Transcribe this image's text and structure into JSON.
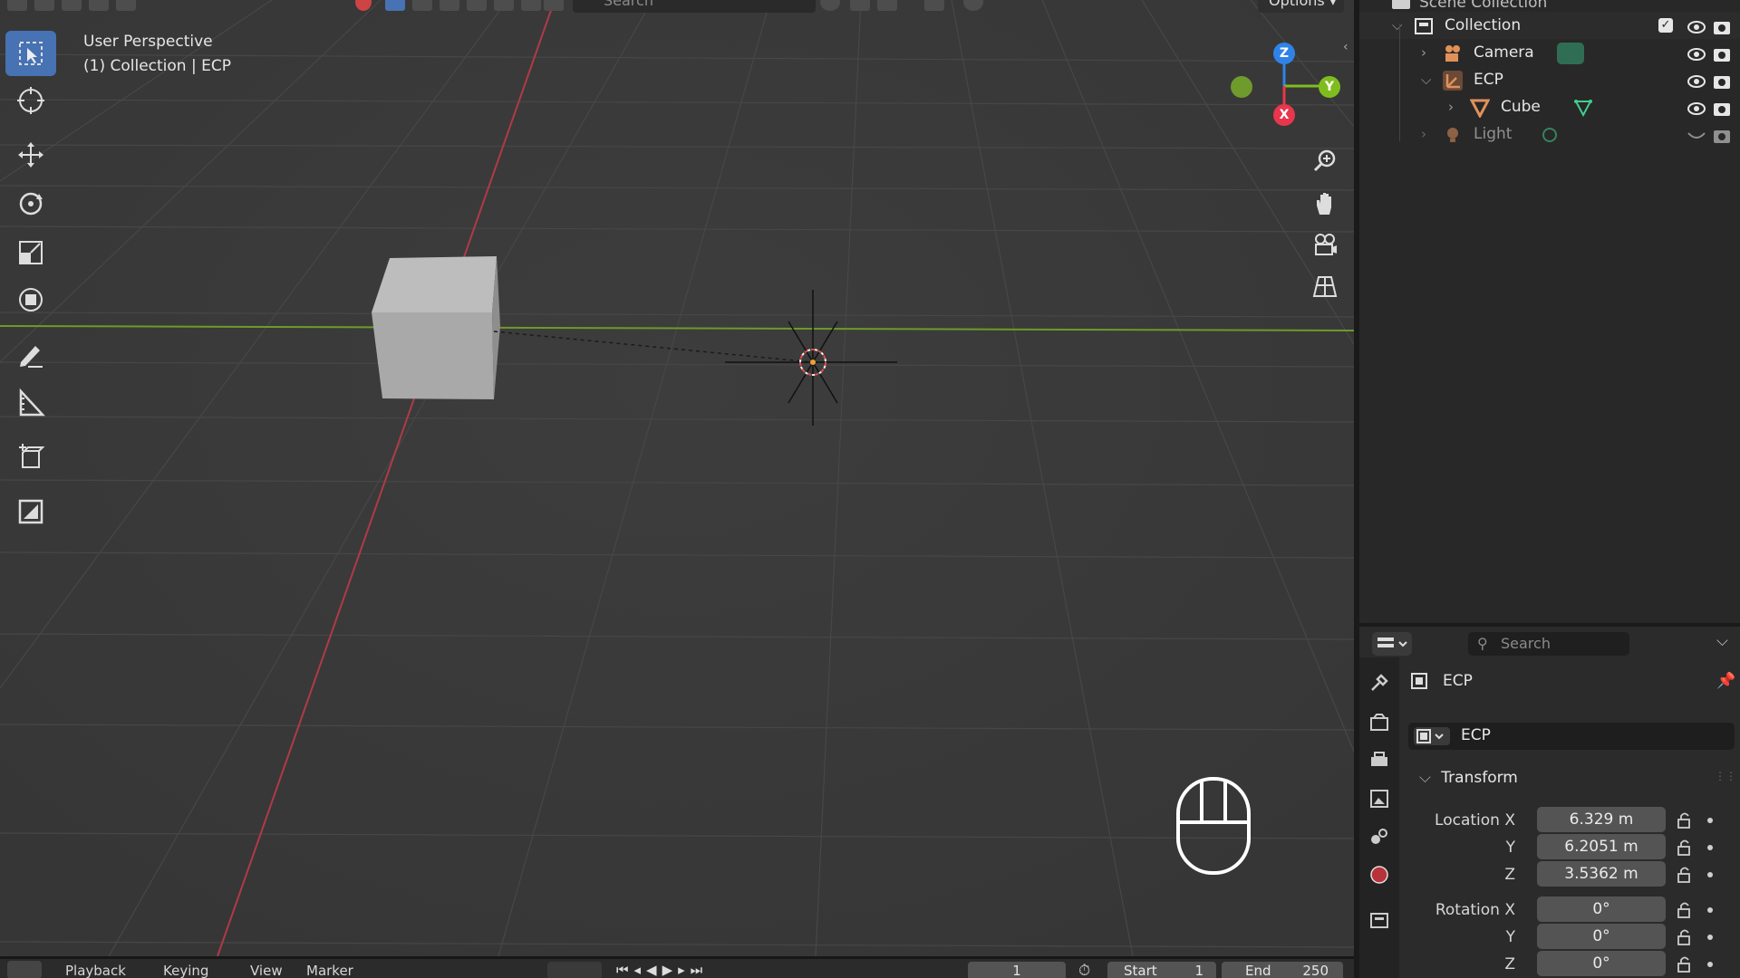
{
  "viewport": {
    "perspective_label": "User Perspective",
    "collection_label": "(1) Collection | ECP",
    "search_placeholder": "Search",
    "options_label": "Options",
    "axis": {
      "z": "Z",
      "y": "Y",
      "x": "X"
    }
  },
  "toolbar": {
    "tools": [
      "select-box",
      "cursor",
      "move",
      "rotate",
      "scale",
      "transform",
      "annotate",
      "measure",
      "add-cube",
      "add-image"
    ],
    "active_tool": "select-box"
  },
  "timeline": {
    "playback": "Playback",
    "keying": "Keying",
    "view": "View",
    "marker": "Marker",
    "current_frame": "1",
    "start_label": "Start",
    "start_value": "1",
    "end_label": "End",
    "end_value": "250"
  },
  "outliner": {
    "scene_collection": "Scene Collection",
    "items": [
      {
        "label": "Collection",
        "icon": "collection-icon"
      },
      {
        "label": "Camera",
        "icon": "camera-icon"
      },
      {
        "label": "ECP",
        "icon": "empty-icon"
      },
      {
        "label": "Cube",
        "icon": "mesh-icon"
      },
      {
        "label": "Light",
        "icon": "light-icon"
      }
    ]
  },
  "properties": {
    "search_placeholder": "Search",
    "object_name": "ECP",
    "object_field": "ECP",
    "transform_label": "Transform",
    "location_x_label": "Location X",
    "y_label": "Y",
    "z_label": "Z",
    "location": {
      "x": "6.329 m",
      "y": "6.2051 m",
      "z": "3.5362 m"
    },
    "rotation_x_label": "Rotation X",
    "rotation": {
      "x": "0°",
      "y": "0°",
      "z": "0°"
    }
  },
  "colors": {
    "viewport_bg": "#393939",
    "active_tool": "#4772b3",
    "x_axis": "#e8364d",
    "y_axis": "#7fbd1f",
    "z_axis": "#2f83e8",
    "panel_bg": "#282828"
  }
}
